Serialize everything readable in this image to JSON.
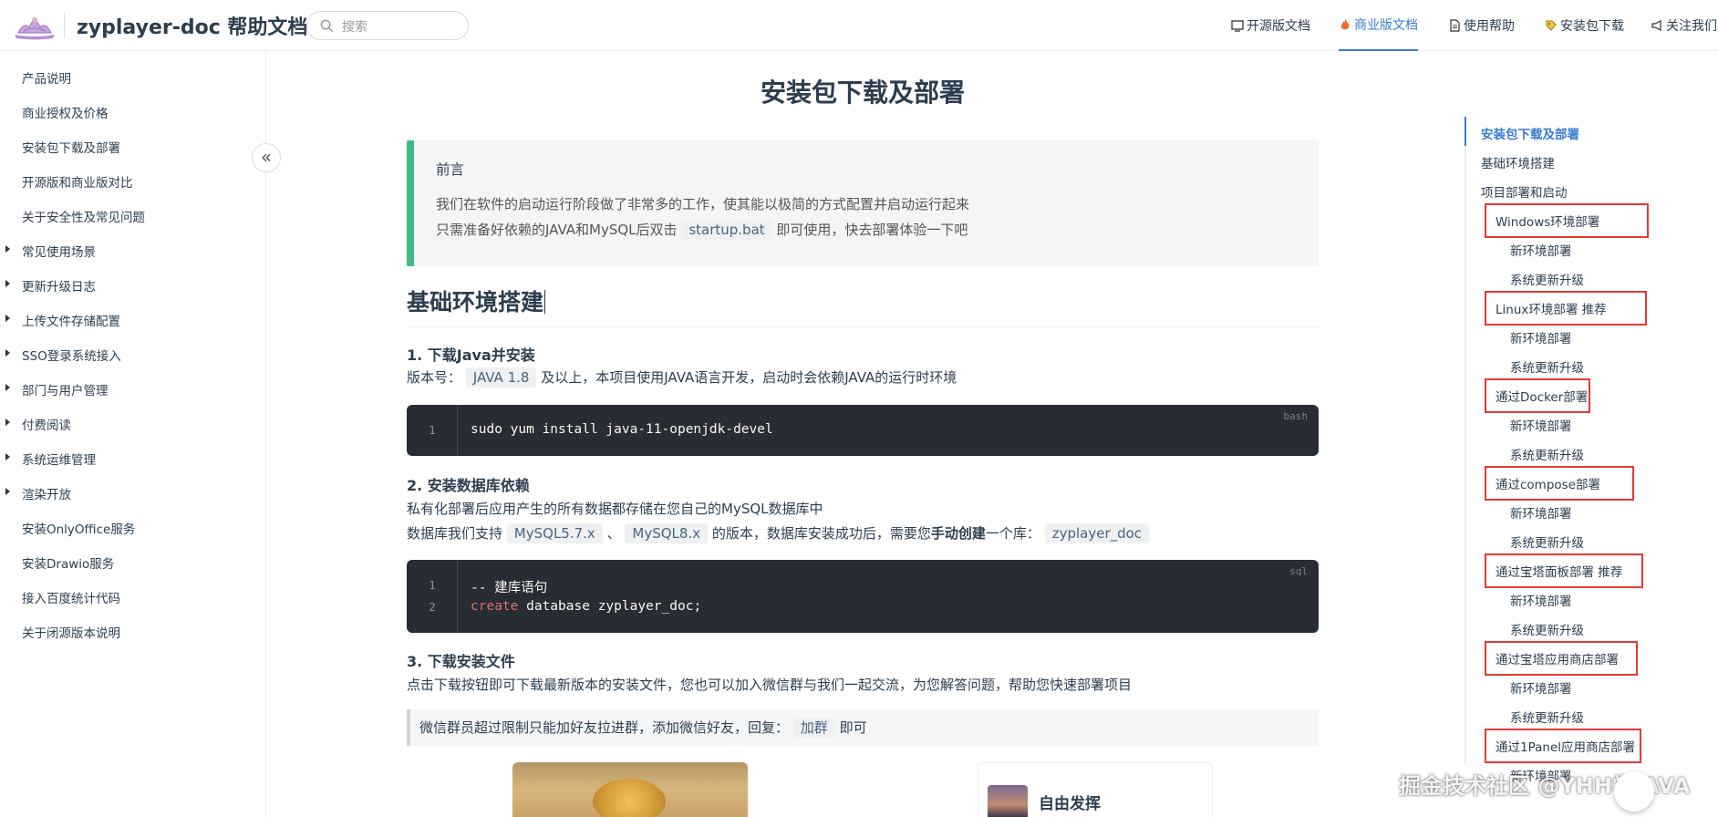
{
  "header": {
    "site_title": "zyplayer-doc 帮助文档",
    "search_placeholder": "搜索",
    "nav": [
      {
        "label": "开源版文档"
      },
      {
        "label": "商业版文档",
        "active": true
      },
      {
        "label": "使用帮助"
      },
      {
        "label": "安装包下载"
      },
      {
        "label": "关注我们"
      }
    ]
  },
  "sidebar": {
    "items": [
      {
        "label": "产品说明",
        "expandable": false
      },
      {
        "label": "商业授权及价格",
        "expandable": false
      },
      {
        "label": "安装包下载及部署",
        "expandable": false
      },
      {
        "label": "开源版和商业版对比",
        "expandable": false
      },
      {
        "label": "关于安全性及常见问题",
        "expandable": false
      },
      {
        "label": "常见使用场景",
        "expandable": true
      },
      {
        "label": "更新升级日志",
        "expandable": true
      },
      {
        "label": "上传文件存储配置",
        "expandable": true
      },
      {
        "label": "SSO登录系统接入",
        "expandable": true
      },
      {
        "label": "部门与用户管理",
        "expandable": true
      },
      {
        "label": "付费阅读",
        "expandable": true
      },
      {
        "label": "系统运维管理",
        "expandable": true
      },
      {
        "label": "渲染开放",
        "expandable": true
      },
      {
        "label": "安装OnlyOffice服务",
        "expandable": false
      },
      {
        "label": "安装Drawio服务",
        "expandable": false
      },
      {
        "label": "接入百度统计代码",
        "expandable": false
      },
      {
        "label": "关于闭源版本说明",
        "expandable": false
      }
    ],
    "collapse_glyph": "«"
  },
  "main": {
    "title": "安装包下载及部署",
    "tip": {
      "title": "前言",
      "line1": "我们在软件的启动运行阶段做了非常多的工作，使其能以极简的方式配置并启动运行起来",
      "line2_pre": "只需准备好依赖的JAVA和MySQL后双击",
      "line2_code": "startup.bat",
      "line2_post": "即可使用，快去部署体验一下吧"
    },
    "h2": "基础环境搭建",
    "s1": {
      "title": "1. 下载Java并安装",
      "p_pre": "版本号：",
      "p_code": "JAVA 1.8",
      "p_post": "及以上，本项目使用JAVA语言开发，启动时会依赖JAVA的运行时环境",
      "code_lang": "bash",
      "code_ln": "1",
      "code_line": "sudo yum install java-11-openjdk-devel"
    },
    "s2": {
      "title": "2. 安装数据库依赖",
      "p1": "私有化部署后应用产生的所有数据都存储在您自己的MySQL数据库中",
      "p2_a": "数据库我们支持",
      "p2_code1": "MySQL5.7.x",
      "p2_sep": "、",
      "p2_code2": "MySQL8.x",
      "p2_b": "的版本，数据库安装成功后，需要您",
      "p2_bold": "手动创建",
      "p2_c": "一个库：",
      "p2_code3": "zyplayer_doc",
      "code_lang": "sql",
      "ln1": "1",
      "ln2": "2",
      "line1": "-- 建库语句",
      "line2_kw": "create",
      "line2_rest": " database zyplayer_doc;"
    },
    "s3": {
      "title": "3. 下载安装文件",
      "p": "点击下载按钮即可下载最新版本的安装文件，您也可以加入微信群与我们一起交流，为您解答问题，帮助您快速部署项目",
      "quote_pre": "微信群员超过限制只能加好友拉进群，添加微信好友，回复：",
      "quote_code": "加群",
      "quote_post": "即可"
    },
    "card2_title": "自由发挥"
  },
  "toc": {
    "items": [
      {
        "label": "安装包下载及部署",
        "level": 1,
        "active": true
      },
      {
        "label": "基础环境搭建",
        "level": 1
      },
      {
        "label": "项目部署和启动",
        "level": 1
      },
      {
        "label": "Windows环境部署",
        "level": 2,
        "boxed": true
      },
      {
        "label": "新环境部署",
        "level": 3
      },
      {
        "label": "系统更新升级",
        "level": 3
      },
      {
        "label": "Linux环境部署 推荐",
        "level": 2,
        "boxed": true
      },
      {
        "label": "新环境部署",
        "level": 3
      },
      {
        "label": "系统更新升级",
        "level": 3
      },
      {
        "label": "通过Docker部署",
        "level": 2,
        "boxed": true
      },
      {
        "label": "新环境部署",
        "level": 3
      },
      {
        "label": "系统更新升级",
        "level": 3
      },
      {
        "label": "通过compose部署",
        "level": 2,
        "boxed": true
      },
      {
        "label": "新环境部署",
        "level": 3
      },
      {
        "label": "系统更新升级",
        "level": 3
      },
      {
        "label": "通过宝塔面板部署 推荐",
        "level": 2,
        "boxed": true
      },
      {
        "label": "新环境部署",
        "level": 3
      },
      {
        "label": "系统更新升级",
        "level": 3
      },
      {
        "label": "通过宝塔应用商店部署",
        "level": 2,
        "boxed": true
      },
      {
        "label": "新环境部署",
        "level": 3
      },
      {
        "label": "系统更新升级",
        "level": 3
      },
      {
        "label": "通过1Panel应用商店部署",
        "level": 2,
        "boxed": true
      },
      {
        "label": "新环境部署",
        "level": 3
      }
    ]
  },
  "watermark": "掘金技术社区 @YHH学JAVA",
  "colors": {
    "accent": "#3a7bd5",
    "tip_border": "#42b983",
    "code_bg": "#282c34",
    "highlight_box": "#e53935"
  }
}
